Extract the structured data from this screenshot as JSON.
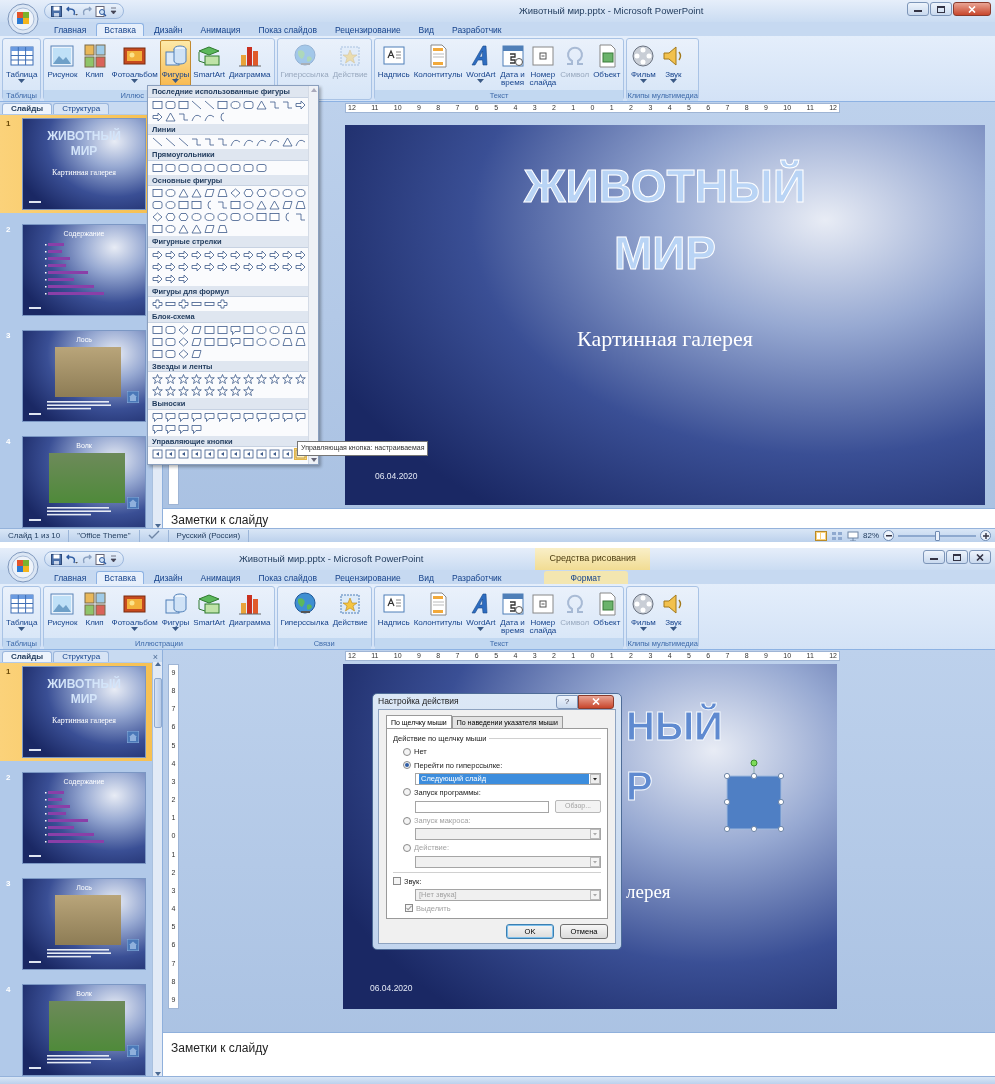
{
  "windows": [
    {
      "title": "Животный мир.pptx - Microsoft PowerPoint",
      "close_highlighted": true,
      "tabs": [
        {
          "label": "Главная",
          "selected": false
        },
        {
          "label": "Вставка",
          "selected": true
        },
        {
          "label": "Дизайн",
          "selected": false
        },
        {
          "label": "Анимация",
          "selected": false
        },
        {
          "label": "Показ слайдов",
          "selected": false
        },
        {
          "label": "Рецензирование",
          "selected": false
        },
        {
          "label": "Вид",
          "selected": false
        },
        {
          "label": "Разработчик",
          "selected": false
        }
      ],
      "groups": [
        {
          "label": "Таблицы",
          "buttons": [
            {
              "kind": "table",
              "label": "Таблица",
              "menu": true,
              "disabled": false,
              "pressed": false
            }
          ]
        },
        {
          "label": "Иллюс",
          "label_cut": true,
          "buttons": [
            {
              "kind": "picture",
              "label": "Рисунок",
              "menu": false,
              "disabled": false,
              "pressed": false
            },
            {
              "kind": "clip",
              "label": "Клип",
              "menu": false,
              "disabled": false,
              "pressed": false
            },
            {
              "kind": "album",
              "label": "Фотоальбом",
              "menu": true,
              "disabled": false,
              "pressed": false
            },
            {
              "kind": "shapes",
              "label": "Фигуры",
              "menu": true,
              "disabled": false,
              "pressed": true
            },
            {
              "kind": "smartart",
              "label": "SmartArt",
              "menu": false,
              "disabled": false,
              "pressed": false
            },
            {
              "kind": "chart",
              "label": "Диаграмма",
              "menu": false,
              "disabled": false,
              "pressed": false
            }
          ]
        },
        {
          "buttons": [
            {
              "kind": "hyperlink",
              "label": "Гиперссылка",
              "menu": false,
              "disabled": true,
              "pressed": false
            },
            {
              "kind": "action",
              "label": "Действие",
              "menu": false,
              "disabled": true,
              "pressed": false
            }
          ]
        },
        {
          "label": "Текст",
          "buttons": [
            {
              "kind": "textbox",
              "label": "Надпись",
              "menu": false,
              "disabled": false,
              "pressed": false
            },
            {
              "kind": "header",
              "label": "Колонтитулы",
              "menu": false,
              "disabled": false,
              "pressed": false
            },
            {
              "kind": "wordart",
              "label": "WordArt",
              "menu": true,
              "disabled": false,
              "pressed": false
            },
            {
              "kind": "date",
              "label": "Дата и\nвремя",
              "menu": false,
              "disabled": false,
              "pressed": false
            },
            {
              "kind": "number",
              "label": "Номер\nслайда",
              "menu": false,
              "disabled": false,
              "pressed": false
            },
            {
              "kind": "symbol",
              "label": "Символ",
              "menu": false,
              "disabled": true,
              "pressed": false
            },
            {
              "kind": "object",
              "label": "Объект",
              "menu": false,
              "disabled": false,
              "pressed": false
            }
          ]
        },
        {
          "label": "Клипы мультимедиа",
          "buttons": [
            {
              "kind": "movie",
              "label": "Фильм",
              "menu": true,
              "disabled": false,
              "pressed": false
            },
            {
              "kind": "sound",
              "label": "Звук",
              "menu": true,
              "disabled": false,
              "pressed": false
            }
          ]
        }
      ],
      "panel_tabs": [
        {
          "label": "Слайды",
          "selected": true
        },
        {
          "label": "Структура",
          "selected": false
        }
      ],
      "thumbnails": [
        {
          "number": "1",
          "selected": true,
          "kind": "title",
          "title_lines": [
            "ЖИВОТНЫЙ",
            "МИР"
          ],
          "subtitle": "Картинная галерея",
          "action_button": false
        },
        {
          "number": "2",
          "selected": false,
          "kind": "contents",
          "title": "Содержание",
          "action_button": false
        },
        {
          "number": "3",
          "selected": false,
          "kind": "photo",
          "title": "Лось",
          "action_button": true
        },
        {
          "number": "4",
          "selected": false,
          "kind": "photo",
          "title": "Волк",
          "action_button": true
        }
      ],
      "ruler": [
        "12",
        "11",
        "10",
        "9",
        "8",
        "7",
        "6",
        "5",
        "4",
        "3",
        "2",
        "1",
        "0",
        "1",
        "2",
        "3",
        "4",
        "5",
        "6",
        "7",
        "8",
        "9",
        "10",
        "11",
        "12"
      ],
      "slide": {
        "kind": "full",
        "title_lines": [
          "ЖИВОТНЫЙ",
          "МИР"
        ],
        "subtitle": "Картинная галерея",
        "date": "06.04.2020",
        "shape_selected": false
      },
      "notes": "Заметки к слайду",
      "status": {
        "items": [
          "Слайд 1 из 10",
          "\"Office Theme\""
        ],
        "language": "Русский (Россия)",
        "zoom": "82%",
        "level": 0.5
      },
      "shapes_menu": {
        "tooltip": "Управляющая кнопка: настраиваемая",
        "sections": [
          {
            "title": "Последние использованные фигуры",
            "last_hovered": false
          },
          {
            "title": "Линии",
            "last_hovered": false
          },
          {
            "title": "Прямоугольники",
            "last_hovered": false
          },
          {
            "title": "Основные фигуры",
            "last_hovered": false
          },
          {
            "title": "Фигурные стрелки",
            "last_hovered": false
          },
          {
            "title": "Фигуры для формул",
            "last_hovered": false
          },
          {
            "title": "Блок-схема",
            "last_hovered": false
          },
          {
            "title": "Звезды и ленты",
            "last_hovered": false
          },
          {
            "title": "Выноски",
            "last_hovered": false
          },
          {
            "title": "Управляющие кнопки",
            "last_hovered": true
          }
        ]
      }
    },
    {
      "title": "Животный мир.pptx - Microsoft PowerPoint",
      "close_highlighted": false,
      "context": {
        "header": "Средства рисования",
        "tab": {
          "label": "Формат",
          "selected": false
        }
      },
      "tabs": [
        {
          "label": "Главная",
          "selected": false
        },
        {
          "label": "Вставка",
          "selected": true
        },
        {
          "label": "Дизайн",
          "selected": false
        },
        {
          "label": "Анимация",
          "selected": false
        },
        {
          "label": "Показ слайдов",
          "selected": false
        },
        {
          "label": "Рецензирование",
          "selected": false
        },
        {
          "label": "Вид",
          "selected": false
        },
        {
          "label": "Разработчик",
          "selected": false
        }
      ],
      "groups": [
        {
          "label": "Таблицы",
          "buttons": [
            {
              "kind": "table",
              "label": "Таблица",
              "menu": true,
              "disabled": false,
              "pressed": false
            }
          ]
        },
        {
          "label": "Иллюстрации",
          "buttons": [
            {
              "kind": "picture",
              "label": "Рисунок",
              "menu": false,
              "disabled": false,
              "pressed": false
            },
            {
              "kind": "clip",
              "label": "Клип",
              "menu": false,
              "disabled": false,
              "pressed": false
            },
            {
              "kind": "album",
              "label": "Фотоальбом",
              "menu": true,
              "disabled": false,
              "pressed": false
            },
            {
              "kind": "shapes",
              "label": "Фигуры",
              "menu": true,
              "disabled": false,
              "pressed": false
            },
            {
              "kind": "smartart",
              "label": "SmartArt",
              "menu": false,
              "disabled": false,
              "pressed": false
            },
            {
              "kind": "chart",
              "label": "Диаграмма",
              "menu": false,
              "disabled": false,
              "pressed": false
            }
          ]
        },
        {
          "label": "Связи",
          "buttons": [
            {
              "kind": "hyperlink",
              "label": "Гиперссылка",
              "menu": false,
              "disabled": false,
              "pressed": false
            },
            {
              "kind": "action",
              "label": "Действие",
              "menu": false,
              "disabled": false,
              "pressed": false
            }
          ]
        },
        {
          "label": "Текст",
          "buttons": [
            {
              "kind": "textbox",
              "label": "Надпись",
              "menu": false,
              "disabled": false,
              "pressed": false
            },
            {
              "kind": "header",
              "label": "Колонтитулы",
              "menu": false,
              "disabled": false,
              "pressed": false
            },
            {
              "kind": "wordart",
              "label": "WordArt",
              "menu": true,
              "disabled": false,
              "pressed": false
            },
            {
              "kind": "date",
              "label": "Дата и\nвремя",
              "menu": false,
              "disabled": false,
              "pressed": false
            },
            {
              "kind": "number",
              "label": "Номер\nслайда",
              "menu": false,
              "disabled": false,
              "pressed": false
            },
            {
              "kind": "symbol",
              "label": "Символ",
              "menu": false,
              "disabled": true,
              "pressed": false
            },
            {
              "kind": "object",
              "label": "Объект",
              "menu": false,
              "disabled": false,
              "pressed": false
            }
          ]
        },
        {
          "label": "Клипы мультимедиа",
          "buttons": [
            {
              "kind": "movie",
              "label": "Фильм",
              "menu": true,
              "disabled": false,
              "pressed": false
            },
            {
              "kind": "sound",
              "label": "Звук",
              "menu": true,
              "disabled": false,
              "pressed": false
            }
          ]
        }
      ],
      "panel_tabs": [
        {
          "label": "Слайды",
          "selected": true
        },
        {
          "label": "Структура",
          "selected": false
        }
      ],
      "panel_close": "×",
      "thumbnails": [
        {
          "number": "1",
          "selected": true,
          "kind": "title",
          "title_lines": [
            "ЖИВОТНЫЙ",
            "МИР"
          ],
          "subtitle": "Картинная галерея",
          "action_button": true
        },
        {
          "number": "2",
          "selected": false,
          "kind": "contents",
          "title": "Содержание",
          "action_button": false
        },
        {
          "number": "3",
          "selected": false,
          "kind": "photo",
          "title": "Лось",
          "action_button": true
        },
        {
          "number": "4",
          "selected": false,
          "kind": "photo",
          "title": "Волк",
          "action_button": true
        }
      ],
      "ruler": [
        "12",
        "11",
        "10",
        "9",
        "8",
        "7",
        "6",
        "5",
        "4",
        "3",
        "2",
        "1",
        "0",
        "1",
        "2",
        "3",
        "4",
        "5",
        "6",
        "7",
        "8",
        "9",
        "10",
        "11",
        "12"
      ],
      "vruler": [
        "9",
        "8",
        "7",
        "6",
        "5",
        "4",
        "3",
        "2",
        "1",
        "0",
        "1",
        "2",
        "3",
        "4",
        "5",
        "6",
        "7",
        "8",
        "9"
      ],
      "slide": {
        "kind": "covered",
        "title_lines": [
          "НЫЙ",
          "Р"
        ],
        "subtitle": "лерея",
        "date": "06.04.2020",
        "shape_selected": true
      },
      "notes": "Заметки к слайду",
      "dialog": {
        "title": "Настройка действия",
        "help": "?",
        "tabs": [
          {
            "label": "По щелчку мыши",
            "selected": true
          },
          {
            "label": "По наведении указателя мыши",
            "selected": false
          }
        ],
        "group_label": "Действие по щелчку мыши",
        "options": [
          {
            "label": "Нет",
            "checked": false,
            "disabled": false
          },
          {
            "label": "Перейти по гиперссылке:",
            "checked": true,
            "disabled": false,
            "field": {
              "kind": "select",
              "value": "Следующий слайд",
              "highlighted": true,
              "disabled": false
            }
          },
          {
            "label": "Запуск программы:",
            "checked": false,
            "disabled": false,
            "field": {
              "kind": "input",
              "disabled": false,
              "button": {
                "label": "Обзор...",
                "disabled": true
              }
            }
          },
          {
            "label": "Запуск макроса:",
            "checked": false,
            "disabled": true,
            "field": {
              "kind": "select",
              "highlighted": false,
              "disabled": true
            }
          },
          {
            "label": "Действие:",
            "checked": false,
            "disabled": true,
            "field": {
              "kind": "select",
              "highlighted": false,
              "disabled": true
            }
          }
        ],
        "sound": {
          "label": "Звук:",
          "checked": false,
          "disabled": false,
          "field": {
            "kind": "select",
            "value": "[Нет звука]",
            "highlighted": false,
            "disabled": true
          }
        },
        "highlight": {
          "label": "Выделить",
          "checked": true,
          "disabled": true
        },
        "buttons": [
          {
            "label": "OK",
            "default": true
          },
          {
            "label": "Отмена",
            "default": false
          }
        ]
      }
    }
  ]
}
